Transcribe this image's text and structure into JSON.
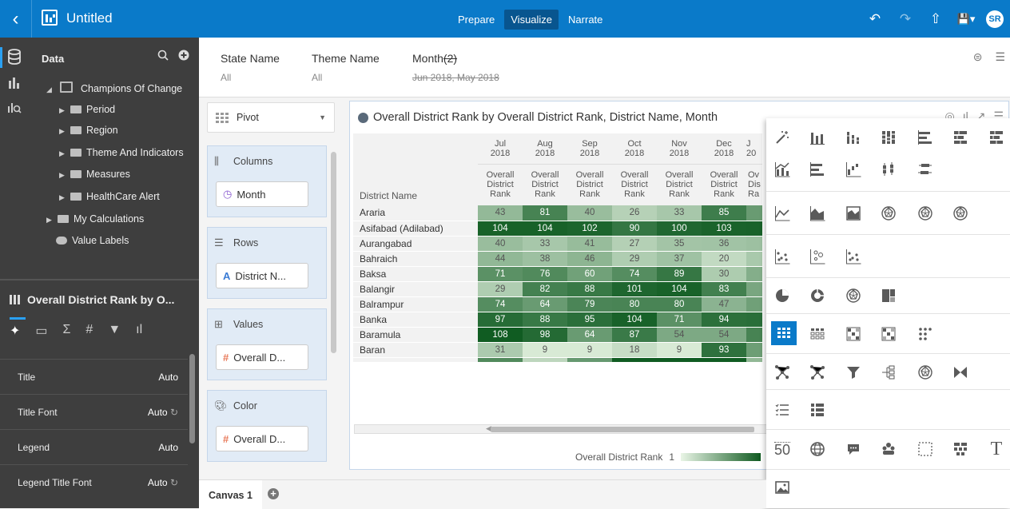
{
  "topbar": {
    "back": "‹",
    "title": "Untitled",
    "modes": [
      {
        "label": "Prepare"
      },
      {
        "label": "Visualize"
      },
      {
        "label": "Narrate"
      }
    ],
    "icons": {
      "undo": "↶",
      "redo": "↷",
      "export": "⇧",
      "save": "💾▾"
    },
    "avatar": "SR",
    "accent": "#0a7ac9"
  },
  "data_panel": {
    "header": "Data",
    "tree": [
      {
        "label": "Champions Of Change",
        "expanded": true
      },
      {
        "label": "Period"
      },
      {
        "label": "Region"
      },
      {
        "label": "Theme And Indicators"
      },
      {
        "label": "Measures"
      },
      {
        "label": "HealthCare Alert"
      },
      {
        "label": "My Calculations"
      },
      {
        "label": "Value Labels"
      }
    ]
  },
  "properties": {
    "title": "Overall District Rank by O...",
    "rows": [
      {
        "label": "Title",
        "value": "Auto"
      },
      {
        "label": "Title Font",
        "value": "Auto"
      },
      {
        "label": "Legend",
        "value": "Auto"
      },
      {
        "label": "Legend Title Font",
        "value": "Auto"
      }
    ]
  },
  "filters": [
    {
      "name": "State Name",
      "value": "All"
    },
    {
      "name": "Theme Name",
      "value": "All"
    },
    {
      "name": "Month",
      "count": "(2)",
      "value": "Jun 2018, May 2018"
    }
  ],
  "grammar": {
    "viz_type": "Pivot",
    "columns_label": "Columns",
    "columns_chip": "Month",
    "rows_label": "Rows",
    "rows_chip": "District N...",
    "values_label": "Values",
    "values_chip": "Overall D...",
    "color_label": "Color",
    "color_chip": "Overall D..."
  },
  "viz": {
    "title": "Overall District Rank by Overall District Rank, District Name, Month",
    "row_header": "District Name",
    "months": [
      {
        "m": "Jul",
        "y": "2018"
      },
      {
        "m": "Aug",
        "y": "2018"
      },
      {
        "m": "Sep",
        "y": "2018"
      },
      {
        "m": "Oct",
        "y": "2018"
      },
      {
        "m": "Nov",
        "y": "2018"
      },
      {
        "m": "Dec",
        "y": "2018"
      },
      {
        "m": "J",
        "y": "20"
      }
    ],
    "measure_label": "Overall District Rank",
    "measure_label_cut": "Ov Dis Ra",
    "rows": [
      {
        "name": "Araria",
        "values": [
          43,
          81,
          40,
          26,
          33,
          85
        ]
      },
      {
        "name": "Asifabad (Adilabad)",
        "values": [
          104,
          104,
          102,
          90,
          100,
          103
        ]
      },
      {
        "name": "Aurangabad",
        "values": [
          40,
          33,
          41,
          27,
          35,
          36
        ]
      },
      {
        "name": "Bahraich",
        "values": [
          44,
          38,
          46,
          29,
          37,
          20
        ]
      },
      {
        "name": "Baksa",
        "values": [
          71,
          76,
          60,
          74,
          89,
          30
        ]
      },
      {
        "name": "Balangir",
        "values": [
          29,
          82,
          88,
          101,
          104,
          83
        ]
      },
      {
        "name": "Balrampur",
        "values": [
          74,
          64,
          79,
          80,
          80,
          47
        ]
      },
      {
        "name": "Banka",
        "values": [
          97,
          88,
          95,
          104,
          71,
          94
        ]
      },
      {
        "name": "Baramula",
        "values": [
          108,
          98,
          64,
          87,
          54,
          54
        ]
      },
      {
        "name": "Baran",
        "values": [
          31,
          9,
          9,
          18,
          9,
          93
        ]
      }
    ],
    "legend_label": "Overall District Rank",
    "legend_min": "1"
  },
  "palette": {
    "counter_label": "50",
    "text_glyph": "T"
  },
  "canvas": {
    "tab": "Canvas 1",
    "add": "+"
  }
}
